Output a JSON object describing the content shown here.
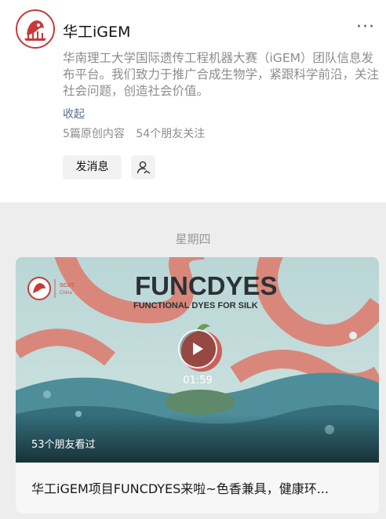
{
  "account": {
    "name": "华工iGEM",
    "avatar_icon": "scut-igem-logo",
    "description": "华南理工大学国际遗传工程机器大赛（iGEM）团队信息发布平台。我们致力于推广合成生物学，紧跟科学前沿，关注社会问题，创造社会价值。",
    "collapse_label": "收起",
    "original_count": "5篇原创内容",
    "friends_following": "54个朋友关注",
    "message_button": "发消息",
    "more_icon": "···"
  },
  "feed": {
    "day_label": "星期四",
    "card": {
      "cover_title": "FUNCDYES",
      "cover_subtitle": "FUNCTIONAL DYES FOR SILK",
      "cover_logo_text": "SCUT",
      "cover_logo_sub": "China",
      "duration": "01:59",
      "friends_watched": "53个朋友看过",
      "title": "华工iGEM项目FUNCDYES来啦~色香兼具，健康环..."
    }
  },
  "colors": {
    "link": "#576b95",
    "secondary_text": "#8c8c8c",
    "feed_bg": "#ededed",
    "brand_red": "#c73a3a"
  }
}
